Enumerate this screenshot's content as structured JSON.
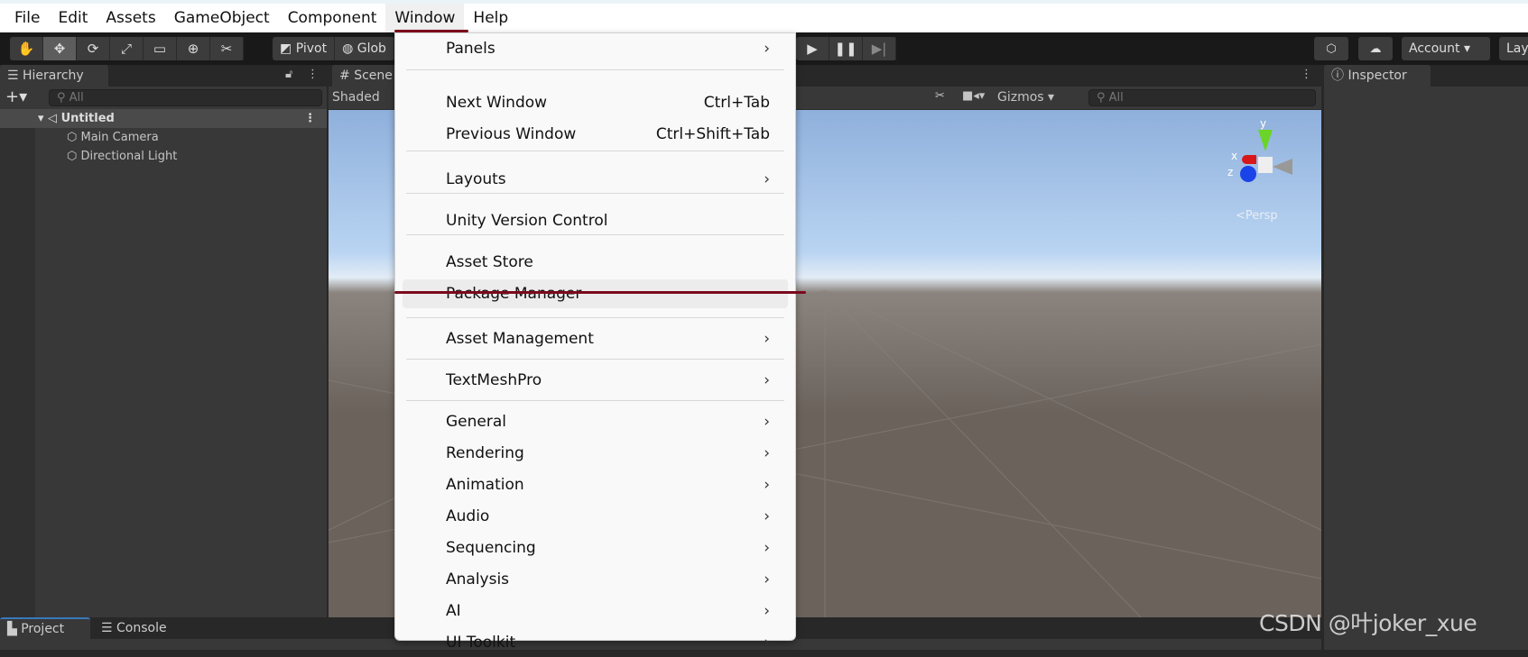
{
  "menubar": {
    "items": [
      "File",
      "Edit",
      "Assets",
      "GameObject",
      "Component",
      "Window",
      "Help"
    ]
  },
  "toolbar": {
    "pivot": "Pivot",
    "global": "Glob",
    "account": "Account",
    "layers": "Lay"
  },
  "hierarchy": {
    "tab": "Hierarchy",
    "search_placeholder": "All",
    "scene": "Untitled",
    "objects": [
      "Main Camera",
      "Directional Light"
    ]
  },
  "scene": {
    "tab": "Scene",
    "shading": "Shaded",
    "gizmos": "Gizmos",
    "search_placeholder": "All",
    "persp": "<Persp",
    "axes": {
      "x": "x",
      "y": "y",
      "z": "z"
    }
  },
  "inspector": {
    "tab": "Inspector"
  },
  "bottom": {
    "tabs": [
      "Project",
      "Console"
    ]
  },
  "watermark": "CSDN @叶joker_xue",
  "window_menu": {
    "items": [
      {
        "label": "Panels",
        "submenu": true
      },
      {
        "label": "Next Window",
        "shortcut": "Ctrl+Tab"
      },
      {
        "label": "Previous Window",
        "shortcut": "Ctrl+Shift+Tab"
      },
      {
        "label": "Layouts",
        "submenu": true
      },
      {
        "label": "Unity Version Control"
      },
      {
        "label": "Asset Store"
      },
      {
        "label": "Package Manager",
        "highlighted": true
      },
      {
        "label": "Asset Management",
        "submenu": true
      },
      {
        "label": "TextMeshPro",
        "submenu": true
      },
      {
        "label": "General",
        "submenu": true
      },
      {
        "label": "Rendering",
        "submenu": true
      },
      {
        "label": "Animation",
        "submenu": true
      },
      {
        "label": "Audio",
        "submenu": true
      },
      {
        "label": "Sequencing",
        "submenu": true
      },
      {
        "label": "Analysis",
        "submenu": true
      },
      {
        "label": "AI",
        "submenu": true
      },
      {
        "label": "UI Toolkit",
        "submenu": true
      }
    ]
  },
  "colors": {
    "annotation": "#7a0a1c",
    "sky_top": "#8fb0dc",
    "ground": "#6b625c"
  }
}
